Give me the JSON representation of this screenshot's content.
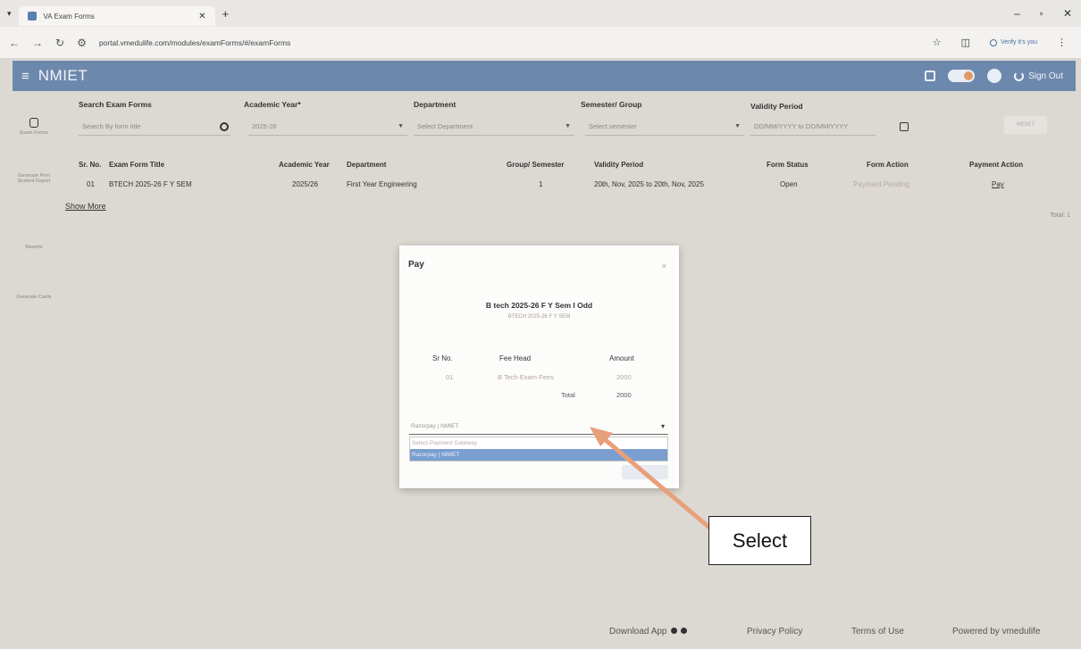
{
  "browser": {
    "tab_title": "VA Exam Forms",
    "url": "portal.vmedulife.com/modules/examForms/#/examForms",
    "verify_label": "Verify it's you"
  },
  "app": {
    "brand": "NMIET",
    "signout_label": "Sign Out"
  },
  "siderail": {
    "items": [
      {
        "label": "Exam Forms"
      },
      {
        "label": "Generate Print Student Report"
      },
      {
        "label": "Reports"
      },
      {
        "label": "Generate Cards"
      }
    ]
  },
  "filters": {
    "search_label": "Search Exam Forms",
    "search_placeholder": "Search By form title",
    "year_label": "Academic Year*",
    "year_value": "2025-26",
    "dept_label": "Department",
    "dept_value": "Select Department",
    "sem_label": "Semester/ Group",
    "sem_value": "Select semester",
    "validity_label": "Validity Period",
    "validity_value": "DD/MM/YYYY to DD/MM/YYYY",
    "reset_label": "RESET"
  },
  "table": {
    "headers": [
      "Sr. No.",
      "Exam Form Title",
      "Academic Year",
      "Department",
      "Group/ Semester",
      "Validity Period",
      "Form Status",
      "Form Action",
      "Payment Action"
    ],
    "row": {
      "sr": "01",
      "title": "BTECH 2025-26 F Y SEM",
      "year": "2025/26",
      "department": "First Year Engineering",
      "semester": "1",
      "validity": "20th, Nov, 2025 to 20th, Nov, 2025",
      "status": "Open",
      "form_action": "Payment Pending",
      "payment_action": "Pay"
    },
    "show_more": "Show More",
    "total": "Total: 1"
  },
  "modal": {
    "title": "Pay",
    "close": "×",
    "heading": "B tech 2025-26 F Y Sem I Odd",
    "subheading": "BTECH 2025-26 F Y SEM",
    "headers": [
      "Sr No.",
      "Fee Head",
      "Amount"
    ],
    "row": {
      "sr": "01",
      "fee_head": "B Tech Exam Fees",
      "amount": "2000"
    },
    "total_label": "Total",
    "total_value": "2000",
    "payment_select": "Razorpay | NMIET",
    "options": [
      "Select Payment Gateway",
      "Razorpay | NMIET"
    ]
  },
  "annotation": {
    "callout": "Select"
  },
  "footer": {
    "download": "Download App",
    "privacy": "Privacy Policy",
    "terms": "Terms of Use",
    "powered": "Powered by vmedulife"
  }
}
